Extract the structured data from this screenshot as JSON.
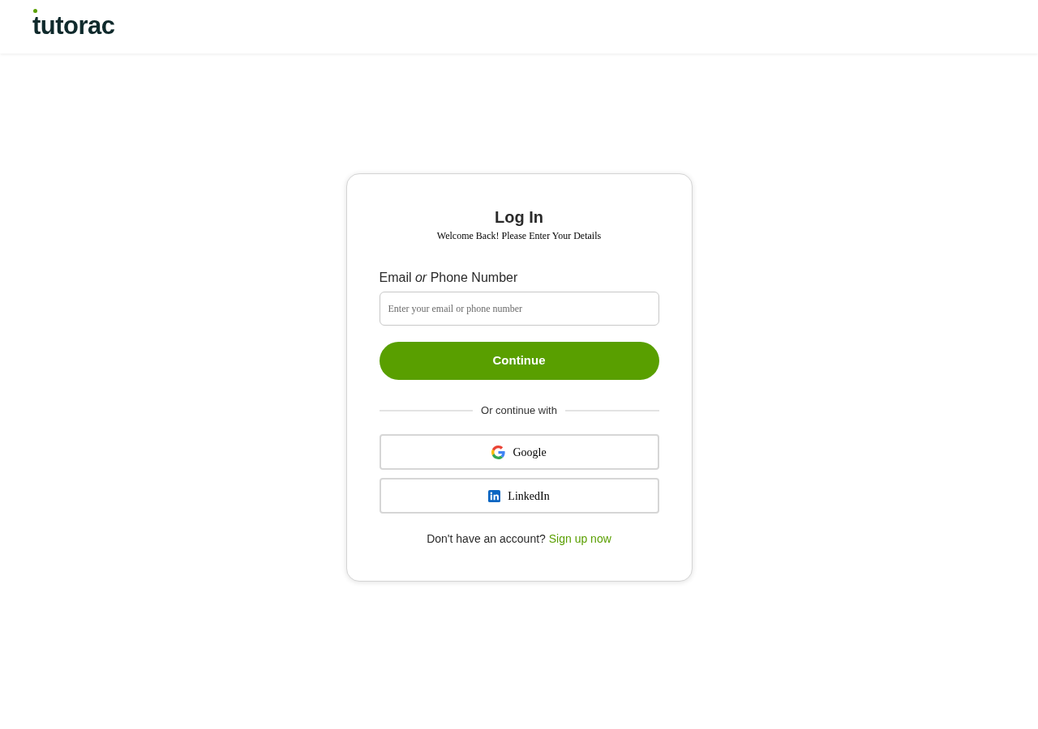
{
  "header": {
    "logo": "tutorac"
  },
  "login": {
    "title": "Log In",
    "subtitle": "Welcome Back! Please Enter Your Details",
    "field": {
      "label": "Email *or* Phone Number",
      "placeholder": "Enter your email or phone number"
    },
    "submit": "Continue",
    "divider": "Or continue with",
    "social": [
      {
        "kind": "google",
        "label": "Google"
      },
      {
        "kind": "linkedin",
        "label": "LinkedIn"
      }
    ],
    "footer": {
      "text": "Don't have an account?",
      "link": "Sign up now"
    }
  }
}
